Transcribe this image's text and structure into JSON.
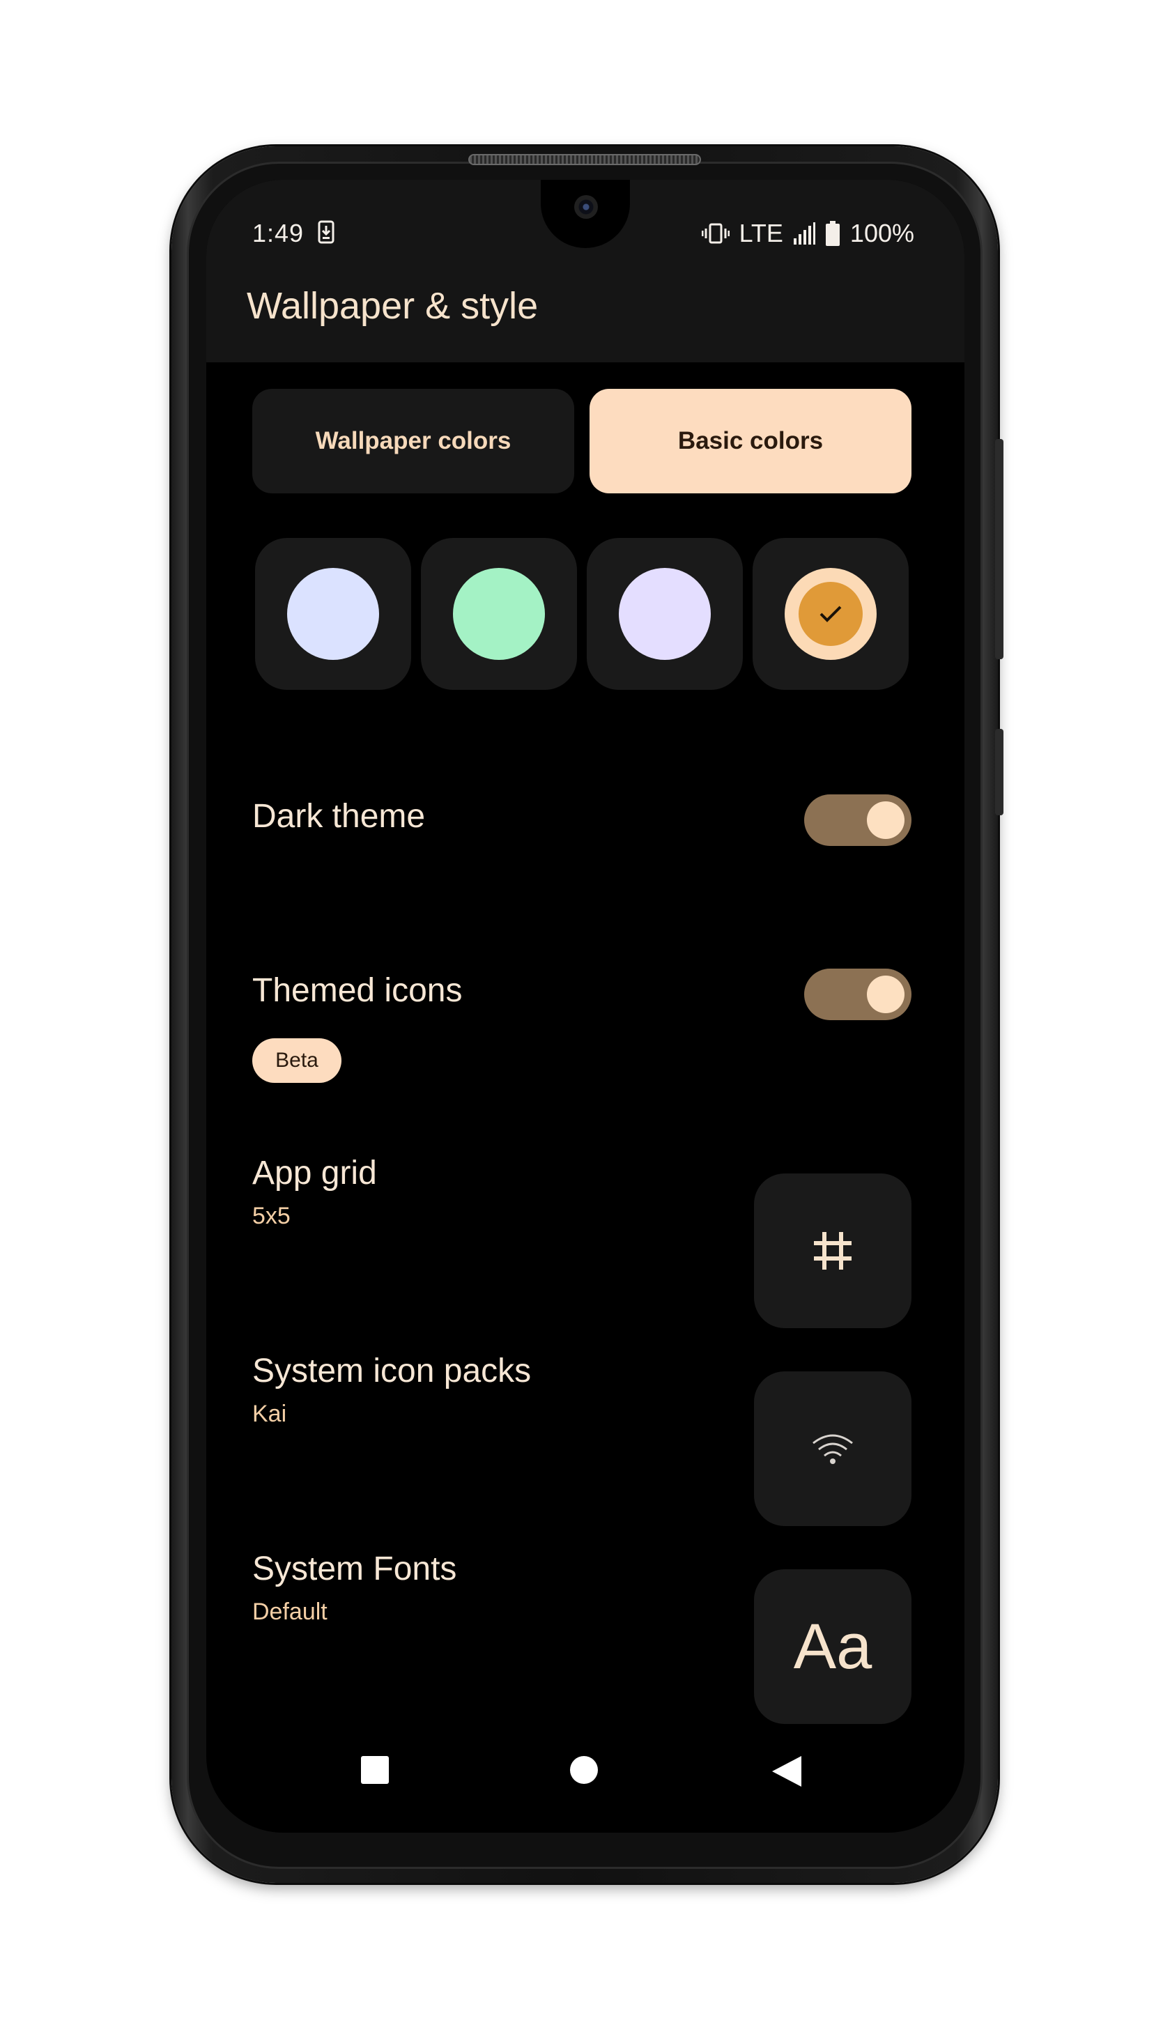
{
  "status_bar": {
    "time": "1:49",
    "network": "LTE",
    "battery": "100%"
  },
  "app_bar": {
    "title": "Wallpaper & style"
  },
  "tabs": [
    {
      "label": "Wallpaper colors",
      "selected": false
    },
    {
      "label": "Basic colors",
      "selected": true
    }
  ],
  "color_options": [
    {
      "color": "#dbe2ff",
      "selected": false
    },
    {
      "color": "#a4f2c5",
      "selected": false
    },
    {
      "color": "#e4deff",
      "selected": false
    },
    {
      "color": "#e09a38",
      "ring_color": "#fcdab6",
      "selected": true
    }
  ],
  "settings": {
    "dark_theme": {
      "label": "Dark theme",
      "enabled": true
    },
    "themed_icons": {
      "label": "Themed icons",
      "badge": "Beta",
      "enabled": true
    },
    "app_grid": {
      "label": "App grid",
      "value": "5x5",
      "icon": "grid-hash-icon"
    },
    "system_icon_packs": {
      "label": "System icon packs",
      "value": "Kai",
      "icon": "wifi-icon"
    },
    "system_fonts": {
      "label": "System Fonts",
      "value": "Default",
      "preview": "Aa"
    }
  },
  "navigation": {
    "icons": [
      "recents-square-icon",
      "home-circle-icon",
      "back-triangle-icon"
    ]
  },
  "colors": {
    "accent": "#fddcbf",
    "toggle_track": "#8c7153",
    "surface": "#1a1a1a",
    "background": "#000000"
  }
}
